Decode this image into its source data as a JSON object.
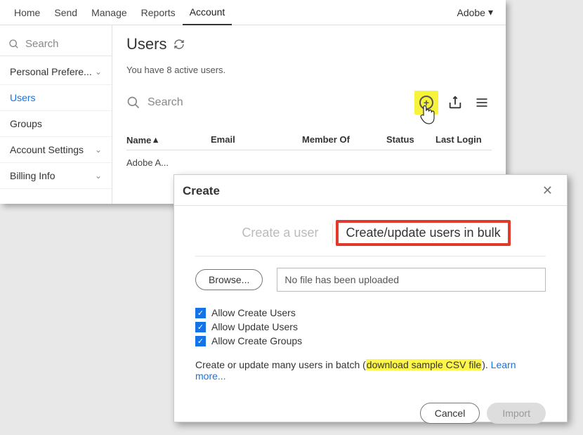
{
  "topnav": {
    "tabs": [
      "Home",
      "Send",
      "Manage",
      "Reports",
      "Account"
    ],
    "activeIndex": 4,
    "brand": "Adobe"
  },
  "sidebar": {
    "searchPlaceholder": "Search",
    "items": [
      {
        "label": "Personal Prefere...",
        "hasChevron": true,
        "active": false
      },
      {
        "label": "Users",
        "hasChevron": false,
        "active": true
      },
      {
        "label": "Groups",
        "hasChevron": false,
        "active": false
      },
      {
        "label": "Account Settings",
        "hasChevron": true,
        "active": false
      },
      {
        "label": "Billing Info",
        "hasChevron": true,
        "active": false
      }
    ]
  },
  "page": {
    "title": "Users",
    "countText": "You have 8 active users.",
    "searchPlaceholder": "Search",
    "columns": {
      "name": "Name",
      "email": "Email",
      "member": "Member Of",
      "status": "Status",
      "last": "Last Login"
    },
    "rows": [
      {
        "name": "Adobe A..."
      }
    ]
  },
  "modal": {
    "title": "Create",
    "tabA": "Create a user",
    "tabB": "Create/update users in bulk",
    "browse": "Browse...",
    "fileStatus": "No file has been uploaded",
    "checks": [
      "Allow Create Users",
      "Allow Update Users",
      "Allow Create Groups"
    ],
    "help_prefix": "Create or update many users in batch (",
    "help_link1": "download sample CSV file",
    "help_mid": ").  ",
    "help_link2": "Learn more...",
    "cancel": "Cancel",
    "import": "Import"
  }
}
